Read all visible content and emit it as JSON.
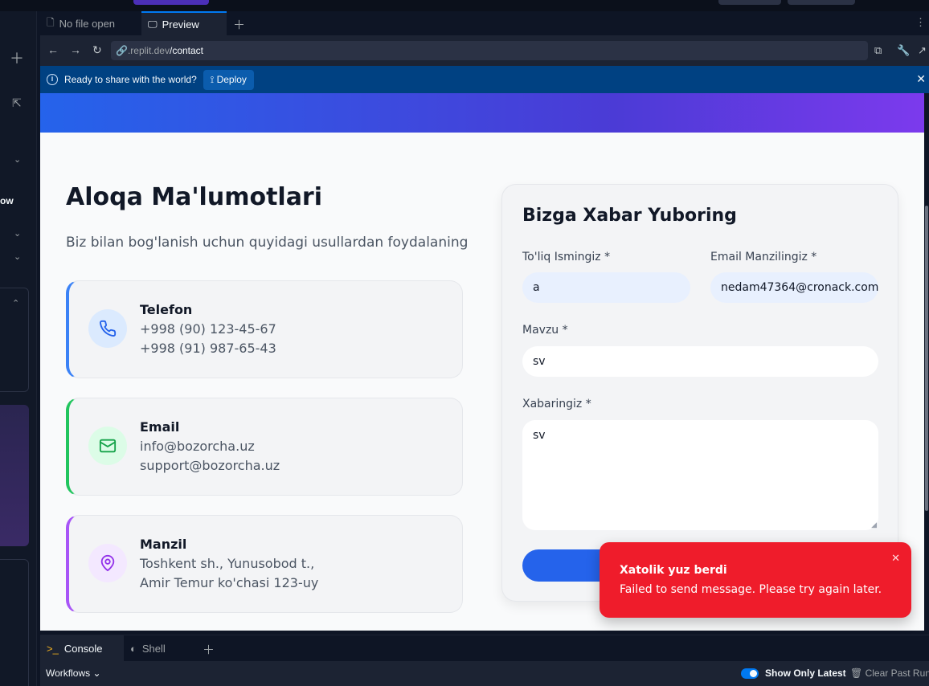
{
  "ide": {
    "tabs": [
      {
        "label": "No file open",
        "icon": "file-icon"
      },
      {
        "label": "Preview",
        "icon": "monitor-icon"
      }
    ],
    "url": {
      "prefix": ".replit.dev",
      "path": "/contact"
    },
    "left_partial_text": "ow",
    "banner": {
      "message": "Ready to share with the world?",
      "deploy_label": "Deploy"
    },
    "bottom": {
      "tabs": [
        {
          "label": "Console",
          "icon": "terminal-icon"
        },
        {
          "label": "Shell",
          "icon": "shell-icon"
        }
      ],
      "workflows_label": "Workflows",
      "show_only_latest_label": "Show Only Latest",
      "show_only_latest_on": true,
      "clear_past_runs_label": "Clear Past Runs"
    }
  },
  "contact": {
    "title": "Aloqa Ma'lumotlari",
    "subtitle": "Biz bilan bog'lanish uchun quyidagi usullardan foydalaning",
    "cards": [
      {
        "heading": "Telefon",
        "line1": "+998 (90) 123-45-67",
        "line2": "+998 (91) 987-65-43",
        "icon": "phone-icon",
        "accent": "#3b82f6",
        "icon_bg": "#dbeafe"
      },
      {
        "heading": "Email",
        "line1": "info@bozorcha.uz",
        "line2": "support@bozorcha.uz",
        "icon": "mail-icon",
        "accent": "#22c55e",
        "icon_bg": "#dcfce7"
      },
      {
        "heading": "Manzil",
        "line1": "Toshkent sh., Yunusobod t.,",
        "line2": "Amir Temur ko'chasi 123-uy",
        "icon": "map-pin-icon",
        "accent": "#a855f7",
        "icon_bg": "#f3e8ff"
      }
    ]
  },
  "form": {
    "title": "Bizga Xabar Yuboring",
    "name_label": "To'liq Ismingiz *",
    "name_value": "a",
    "email_label": "Email Manzilingiz *",
    "email_value": "nedam47364@cronack.com",
    "subject_label": "Mavzu *",
    "subject_value": "sv",
    "message_label": "Xabaringiz *",
    "message_value": "sv"
  },
  "toast": {
    "title": "Xatolik yuz berdi",
    "message": "Failed to send message. Please try again later.",
    "color": "#ef1c2b"
  }
}
